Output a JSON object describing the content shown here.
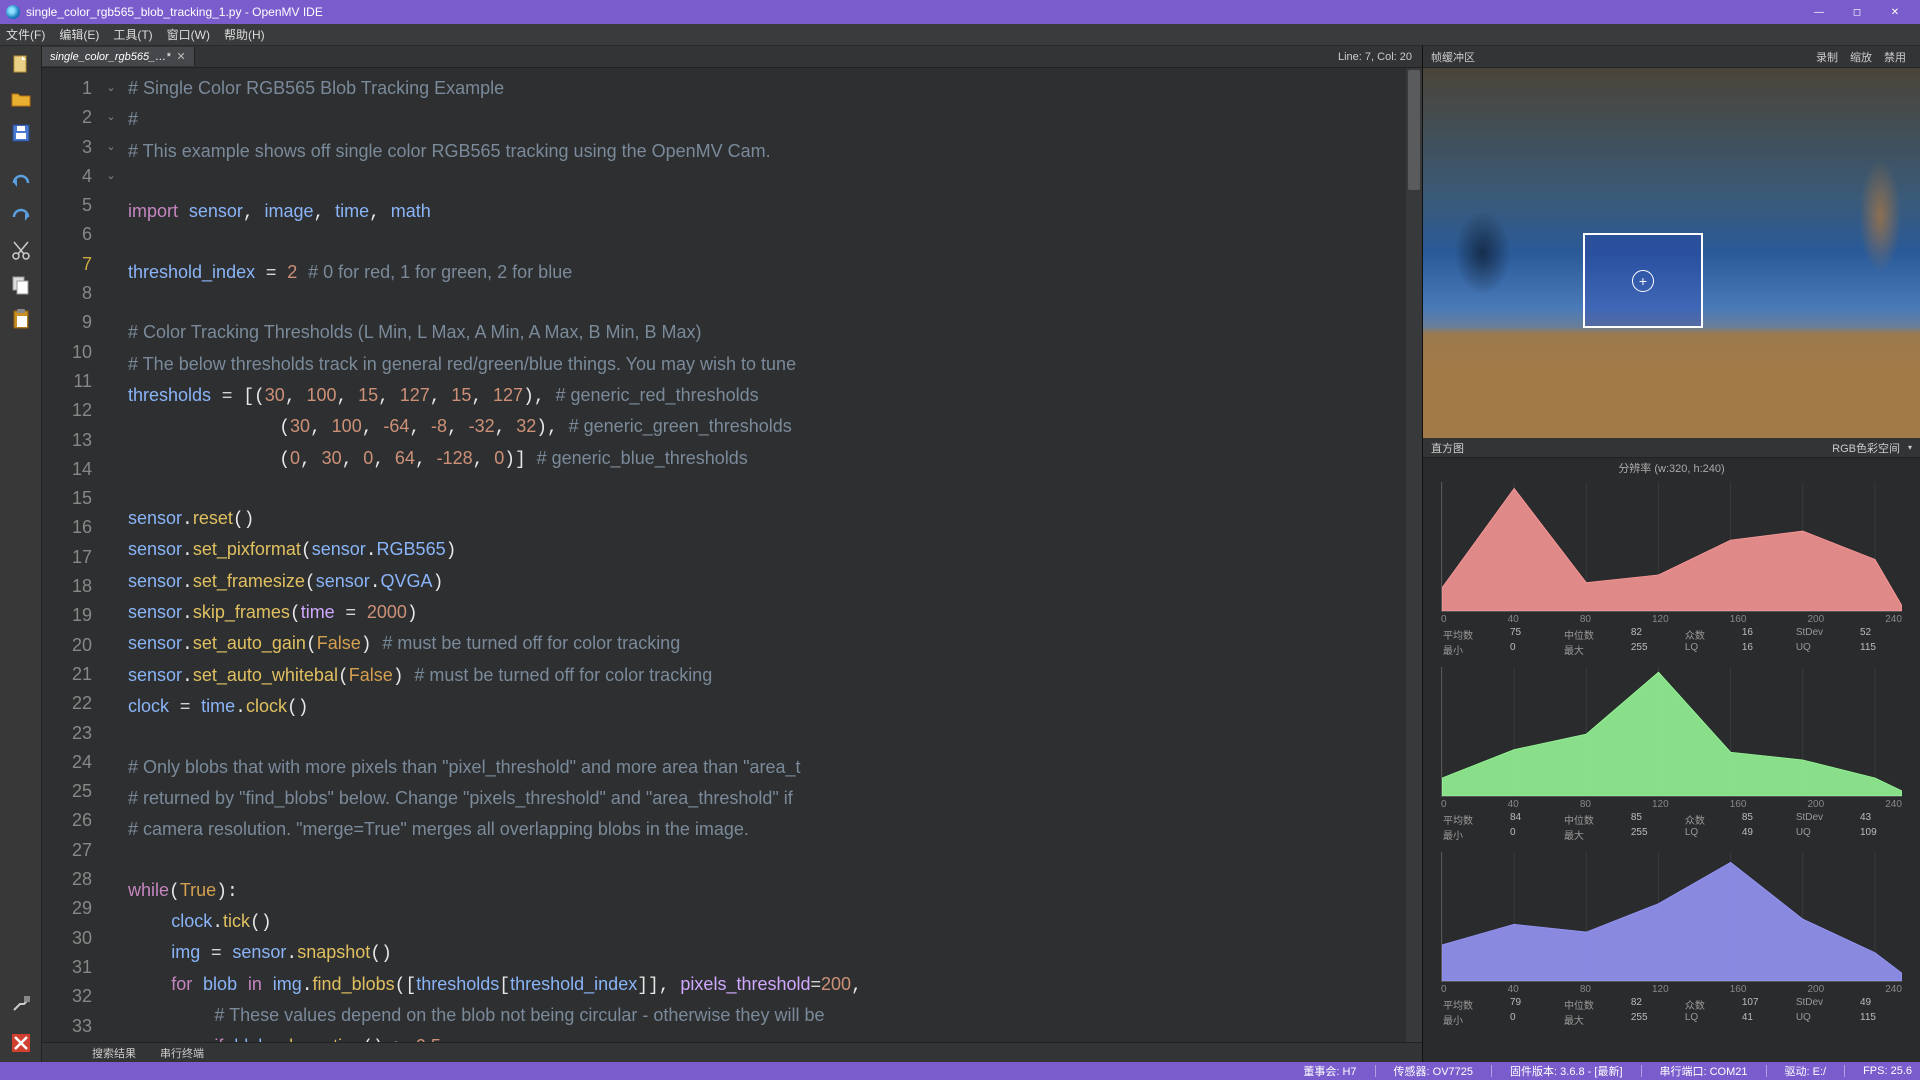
{
  "window": {
    "title": "single_color_rgb565_blob_tracking_1.py - OpenMV IDE",
    "controls": {
      "min": "—",
      "max": "◻",
      "close": "✕"
    }
  },
  "menu": {
    "file": "文件(F)",
    "edit": "编辑(E)",
    "tools": "工具(T)",
    "window": "窗口(W)",
    "help": "帮助(H)"
  },
  "tab": {
    "name": "single_color_rgb565_…*",
    "close": "✕"
  },
  "cursor": {
    "text": "Line: 7, Col: 20"
  },
  "gutter_lines": [
    "1",
    "2",
    "3",
    "4",
    "5",
    "6",
    "7",
    "8",
    "9",
    "10",
    "11",
    "12",
    "13",
    "14",
    "15",
    "16",
    "17",
    "18",
    "19",
    "20",
    "21",
    "22",
    "23",
    "24",
    "25",
    "26",
    "27",
    "28",
    "29",
    "30",
    "31",
    "32",
    "33"
  ],
  "current_line_index": 6,
  "fold_marks": {
    "10": "⌄",
    "26": "⌄",
    "29": "⌄",
    "31": "⌄"
  },
  "bottom_tabs": {
    "search": "搜索结果",
    "serial": "串行终端"
  },
  "right": {
    "fb_title": "帧缓冲区",
    "record": "录制",
    "zoom": "缩放",
    "disable": "禁用",
    "hist_title": "直方图",
    "colorspace": "RGB色彩空间",
    "resolution": "分辨率 (w:320, h:240)",
    "axis": [
      "0",
      "40",
      "80",
      "120",
      "160",
      "200",
      "240"
    ],
    "stat_labels": {
      "mean": "平均数",
      "median": "中位数",
      "mode": "众数",
      "stdev": "StDev",
      "min": "最小",
      "max": "最大",
      "lq": "LQ",
      "uq": "UQ"
    },
    "r": {
      "mean": "75",
      "median": "82",
      "mode": "16",
      "stdev": "52",
      "min": "0",
      "max": "255",
      "lq": "16",
      "uq": "115"
    },
    "g": {
      "mean": "84",
      "median": "85",
      "mode": "85",
      "stdev": "43",
      "min": "0",
      "max": "255",
      "lq": "49",
      "uq": "109"
    },
    "b": {
      "mean": "79",
      "median": "82",
      "mode": "107",
      "stdev": "49",
      "min": "0",
      "max": "255",
      "lq": "41",
      "uq": "115"
    }
  },
  "chart_data": [
    {
      "type": "area",
      "channel": "R",
      "color": "#ff9a9a",
      "x": [
        0,
        40,
        80,
        120,
        160,
        200,
        240,
        255
      ],
      "y": [
        18,
        95,
        22,
        28,
        55,
        62,
        40,
        4
      ],
      "ylim": [
        0,
        100
      ]
    },
    {
      "type": "area",
      "channel": "G",
      "color": "#9aff9a",
      "x": [
        0,
        40,
        80,
        120,
        160,
        200,
        240,
        255
      ],
      "y": [
        14,
        36,
        48,
        96,
        34,
        28,
        14,
        4
      ],
      "ylim": [
        0,
        100
      ]
    },
    {
      "type": "area",
      "channel": "B",
      "color": "#9a9aff",
      "x": [
        0,
        40,
        80,
        120,
        160,
        200,
        240,
        255
      ],
      "y": [
        28,
        44,
        38,
        60,
        92,
        48,
        22,
        6
      ],
      "ylim": [
        0,
        100
      ]
    }
  ],
  "status": {
    "board": "董事会: H7",
    "sensor": "传感器: OV7725",
    "fw": "固件版本: 3.6.8 - [最新]",
    "port": "串行端口: COM21",
    "drive": "驱动: E:/",
    "fps": "FPS: 25.6"
  }
}
